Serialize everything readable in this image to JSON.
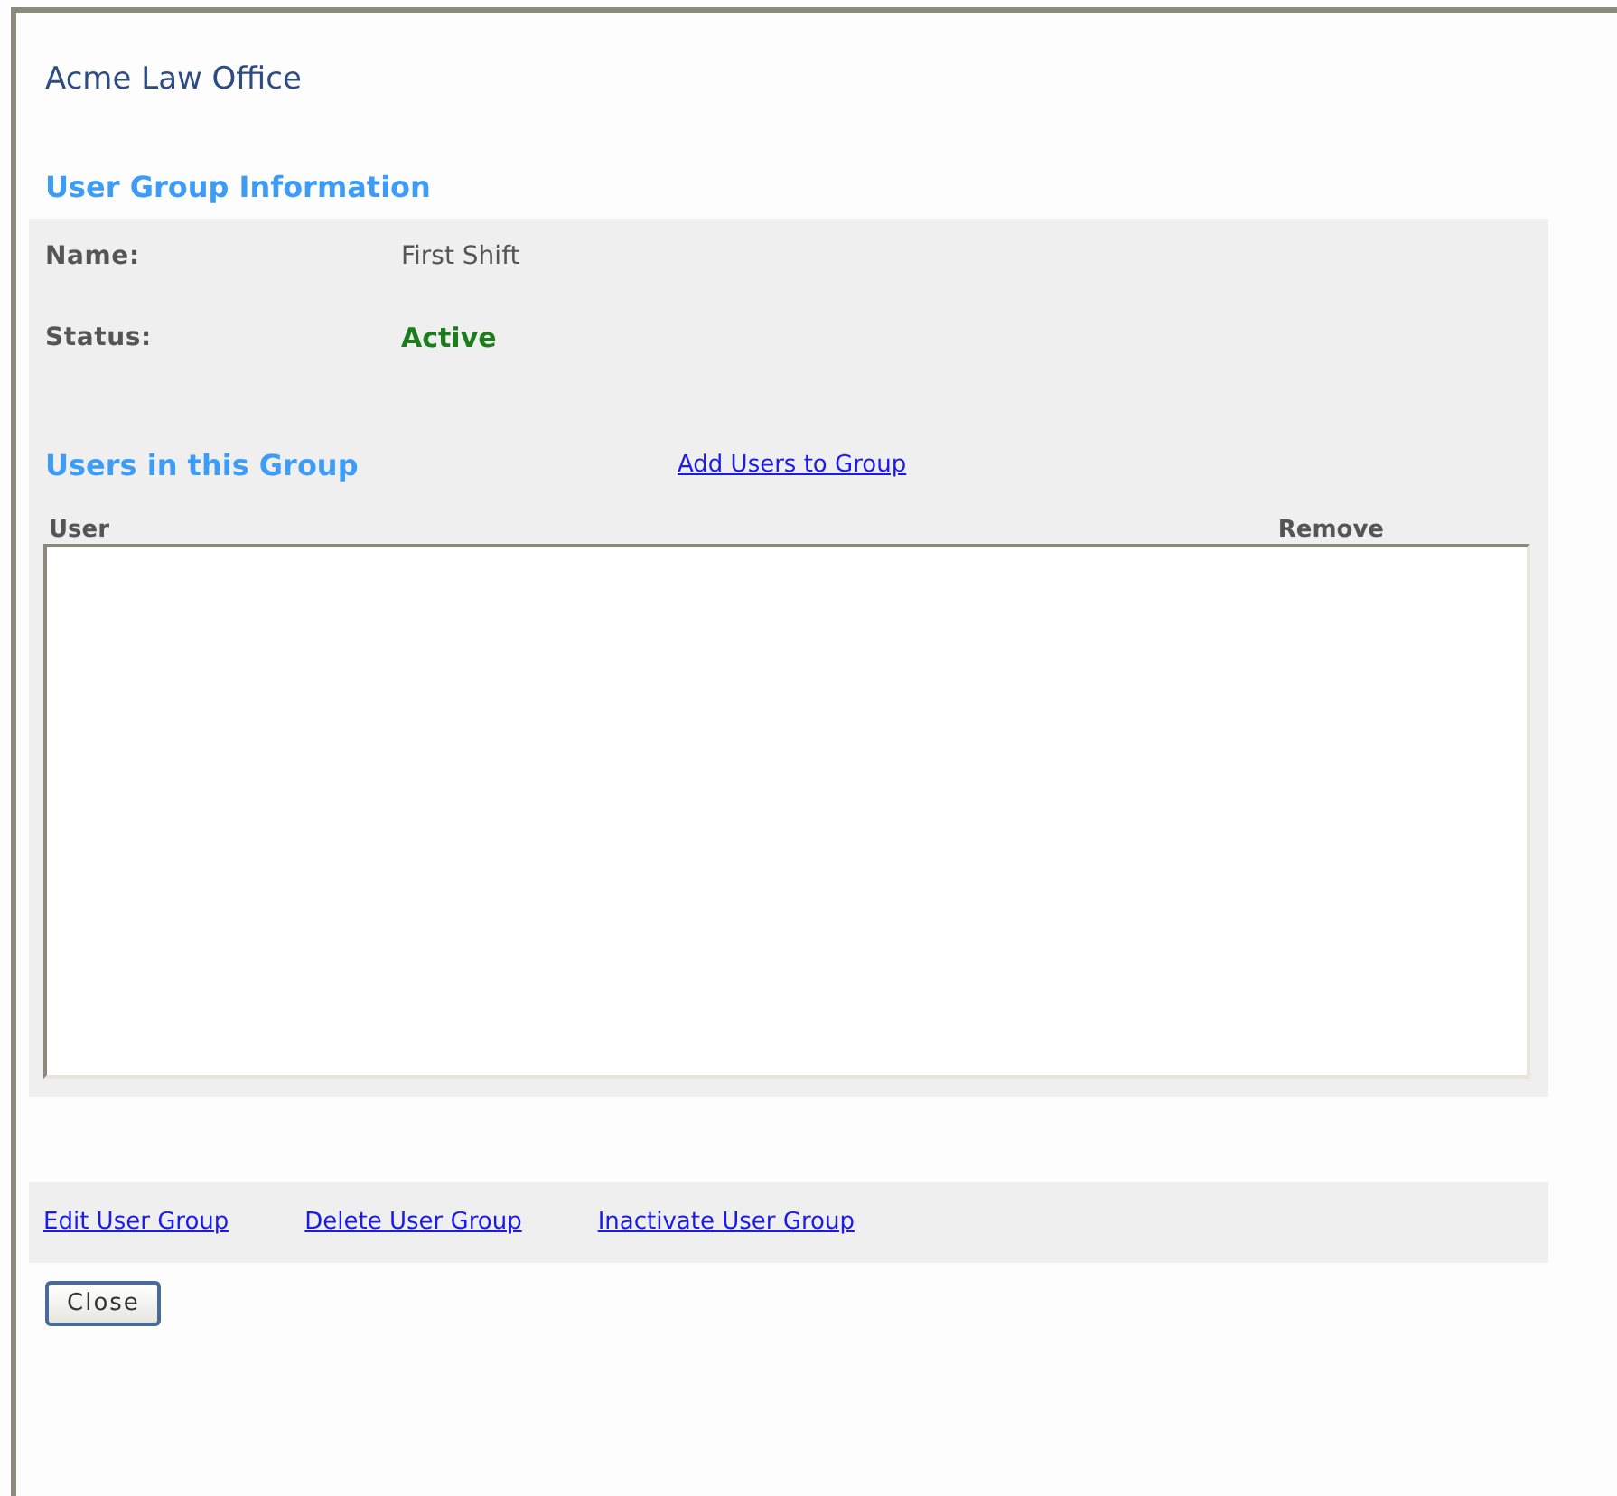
{
  "title": "Acme Law Office",
  "info_heading": "User Group Information",
  "fields": [
    {
      "label": "Name:",
      "value": "First Shift",
      "kind": "plain"
    },
    {
      "label": "Status:",
      "value": "Active",
      "kind": "status"
    }
  ],
  "users_heading": "Users in this Group",
  "add_link": "Add Users to Group",
  "table": {
    "columns": [
      "User",
      "Remove"
    ]
  },
  "actions": [
    "Edit User Group",
    "Delete User Group",
    "Inactivate User Group"
  ],
  "buttons": [
    "Close"
  ]
}
